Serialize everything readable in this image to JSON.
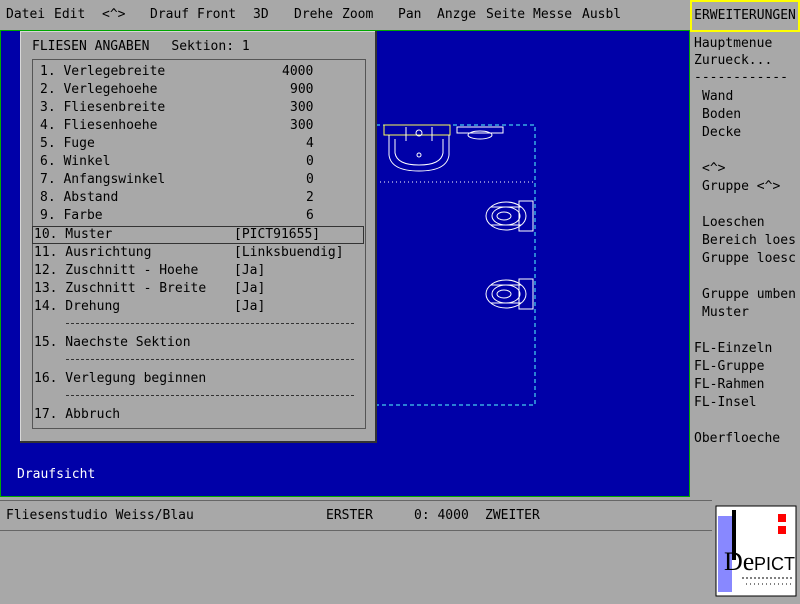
{
  "menubar": {
    "items": [
      "Datei",
      "Edit",
      "<^>",
      "Drauf",
      "Front",
      "3D",
      "Drehe",
      "Zoom",
      "Pan",
      "Anzge",
      "Seite",
      "Messe",
      "Ausbl"
    ]
  },
  "ext_button": "ERWEITERUNGEN",
  "sidebar": {
    "items": [
      "Hauptmenue",
      "Zurueck...",
      "------------",
      "Wand",
      "Boden",
      "Decke",
      "<^>",
      "Gruppe <^>",
      "Loeschen",
      "Bereich loes",
      "Gruppe loesc",
      "Gruppe umben",
      "Muster",
      "FL-Einzeln",
      "FL-Gruppe",
      "FL-Rahmen",
      "FL-Insel",
      "Oberfloeche"
    ]
  },
  "dialog": {
    "title": "FLIESEN ANGABEN",
    "section_label": "Sektion: 1",
    "rows": [
      {
        "label": "1. Verlegebreite",
        "value": "4000"
      },
      {
        "label": "2. Verlegehoehe",
        "value": "900"
      },
      {
        "label": "3. Fliesenbreite",
        "value": "300"
      },
      {
        "label": "4. Fliesenhoehe",
        "value": "300"
      },
      {
        "label": "5. Fuge",
        "value": "4"
      },
      {
        "label": "6. Winkel",
        "value": "0"
      },
      {
        "label": "7. Anfangswinkel",
        "value": "0"
      },
      {
        "label": "8. Abstand",
        "value": "2"
      },
      {
        "label": "9. Farbe",
        "value": "6"
      },
      {
        "label": "10. Muster",
        "value": "[PICT91655]"
      },
      {
        "label": "11. Ausrichtung",
        "value": "[Linksbuendig]"
      },
      {
        "label": "12. Zuschnitt - Hoehe",
        "value": "[Ja]"
      },
      {
        "label": "13. Zuschnitt - Breite",
        "value": "[Ja]"
      },
      {
        "label": "14. Drehung",
        "value": "[Ja]"
      }
    ],
    "next_section": "15. Naechste Sektion",
    "start_laying": "16. Verlegung beginnen",
    "cancel": "17. Abbruch"
  },
  "canvas": {
    "view_label": "Draufsicht"
  },
  "status": {
    "project": "Fliesenstudio Weiss/Blau",
    "first_label": "ERSTER",
    "coord": "0: 4000",
    "second_label": "ZWEITER"
  },
  "logo": {
    "text": "DePICT"
  },
  "colors": {
    "canvas_bg": "#0000a8",
    "panel_bg": "#a8a8a8",
    "highlight": "#ffff00",
    "drawing_lines": "#ffffff",
    "dashed_outline": "#55ffff"
  }
}
